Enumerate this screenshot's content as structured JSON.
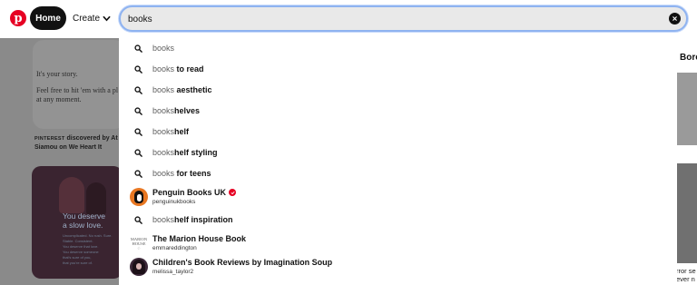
{
  "nav": {
    "logo_letter": "p",
    "home_label": "Home",
    "create_label": "Create"
  },
  "search": {
    "value": "books",
    "suggestions": [
      {
        "typed": "books",
        "completion": ""
      },
      {
        "typed": "books",
        "completion": " to read"
      },
      {
        "typed": "books",
        "completion": " aesthetic"
      },
      {
        "typed": "books",
        "completion": "helves"
      },
      {
        "typed": "books",
        "completion": "helf"
      },
      {
        "typed": "books",
        "completion": "helf styling"
      },
      {
        "typed": "books",
        "completion": " for teens"
      },
      {
        "typed": "books",
        "completion": "helf inspiration"
      }
    ],
    "profiles": [
      {
        "name": "Penguin Books UK",
        "handle": "penguinukbooks",
        "verified": true
      },
      {
        "name": "The Marion House Book",
        "handle": "emmareddington",
        "verified": false,
        "avatar_text": [
          "MARION",
          "HOUSE",
          "♢"
        ]
      },
      {
        "name": "Children's Book Reviews by Imagination Soup",
        "handle": "melissa_taylor2",
        "verified": false
      }
    ]
  },
  "background": {
    "story_lines": [
      "It's your story.",
      "Feel free to hit 'em with a pl",
      "at any moment."
    ],
    "story_caption_brand": "PINTEREST",
    "story_caption_rest": "discovered by At",
    "story_caption_line2": "Siamou on We Heart It",
    "slowlove_title": [
      "You deserve",
      "a slow love."
    ],
    "slowlove_sub": [
      "Uncomplicated. No rush. Sure.",
      "Stable. Consistent.",
      "You deserve that love.",
      "You deserve someone",
      "that's sure of you,",
      "that you're sure of."
    ],
    "right_title": "Bore",
    "right_caption": [
      "rror se",
      "ever n"
    ]
  }
}
